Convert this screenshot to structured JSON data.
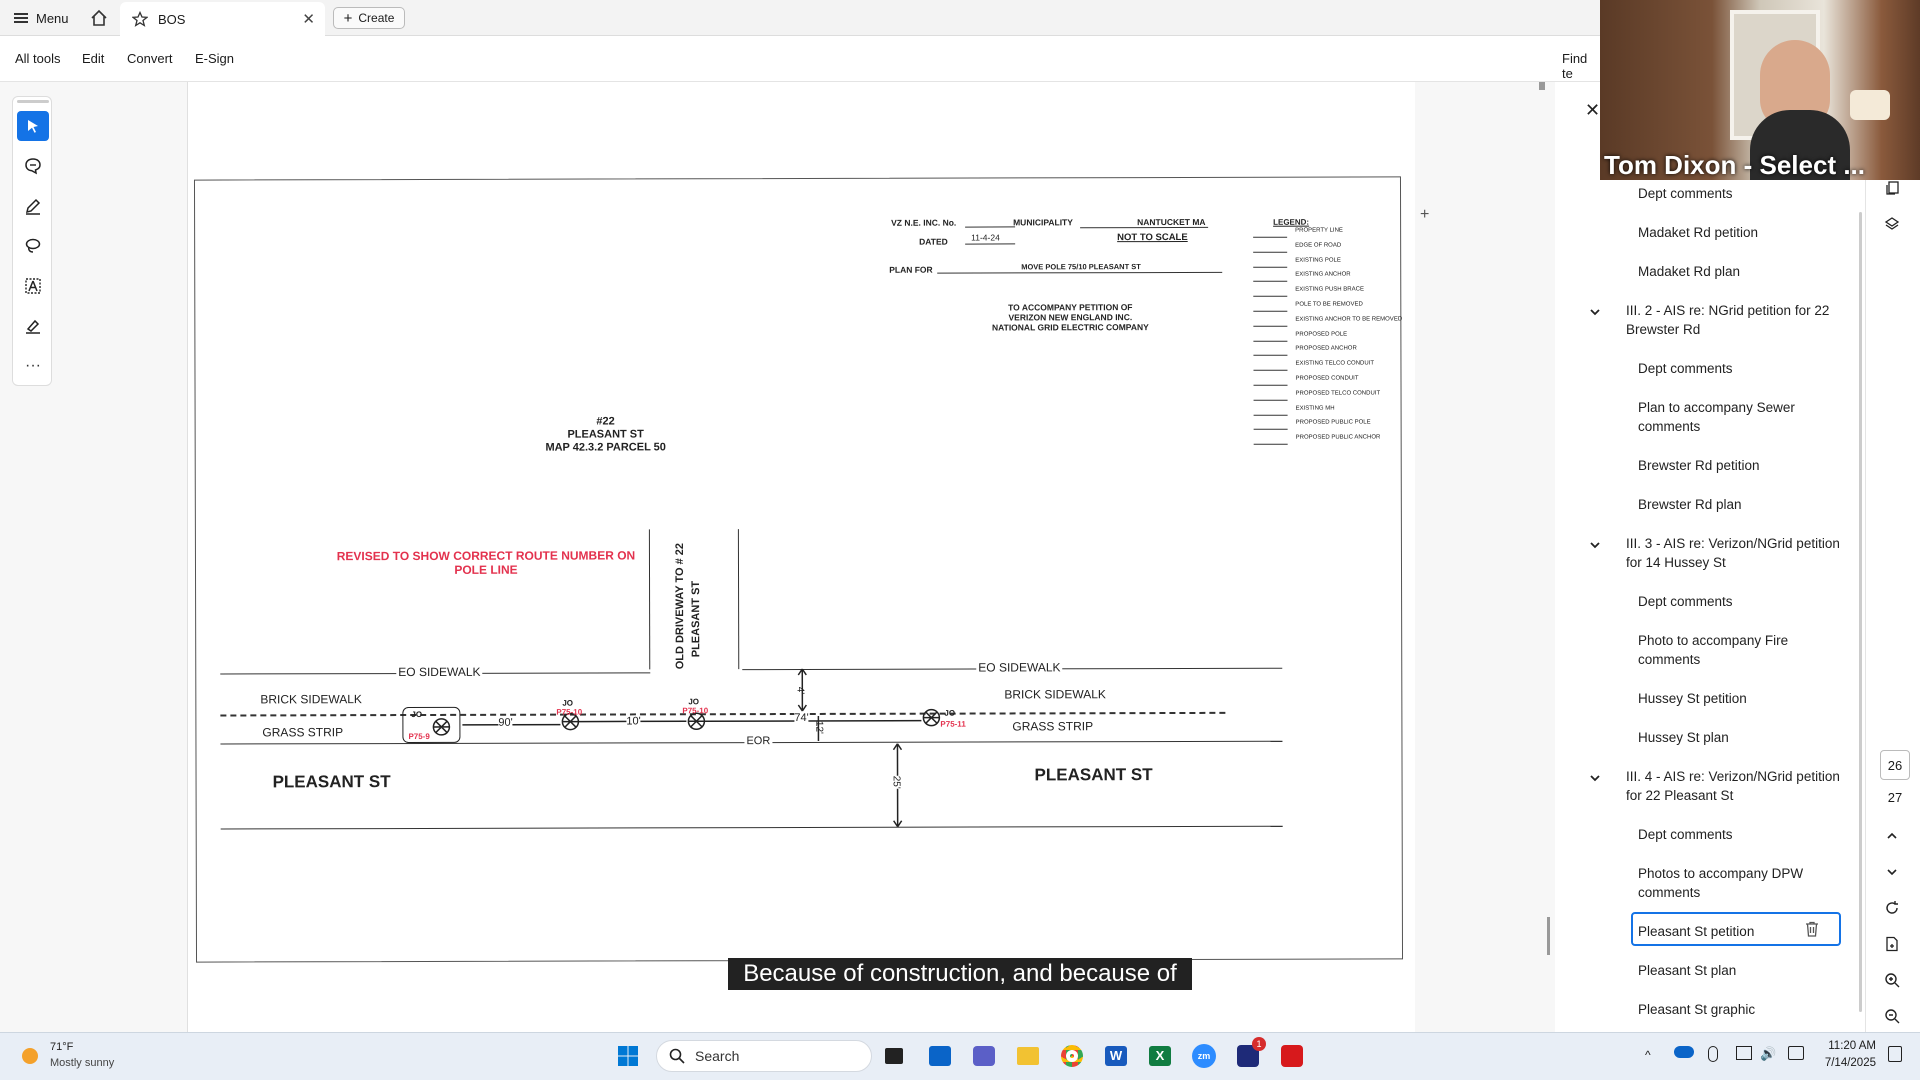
{
  "topbar": {
    "menu_label": "Menu",
    "tab_title": "BOS",
    "create_label": "Create"
  },
  "menubar": {
    "items": [
      "All tools",
      "Edit",
      "Convert",
      "E-Sign"
    ],
    "find_text": "Find te"
  },
  "document": {
    "header": {
      "vz_label": "VZ N.E. INC. No.",
      "municipality_label": "MUNICIPALITY",
      "municipality_value": "NANTUCKET MA",
      "dated_label": "DATED",
      "dated_value": "11-4-24",
      "scale_value": "NOT TO SCALE",
      "plan_for_label": "PLAN FOR",
      "plan_for_value": "MOVE POLE 75/10 PLEASANT ST",
      "accompany_line1": "TO ACCOMPANY PETITION OF",
      "accompany_line2": "VERIZON NEW ENGLAND INC.",
      "accompany_line3": "NATIONAL GRID ELECTRIC COMPANY"
    },
    "legend": {
      "title": "LEGEND:",
      "items": [
        "PROPERTY LINE",
        "EDGE OF ROAD",
        "EXISTING POLE",
        "EXISTING ANCHOR",
        "EXISTING PUSH BRACE",
        "POLE TO BE REMOVED",
        "EXISTING ANCHOR TO BE REMOVED",
        "PROPOSED POLE",
        "PROPOSED ANCHOR",
        "EXISTING TELCO CONDUIT",
        "PROPOSED CONDUIT",
        "PROPOSED TELCO CONDUIT",
        "EXISTING MH",
        "PROPOSED PUBLIC POLE",
        "PROPOSED PUBLIC ANCHOR"
      ]
    },
    "parcel_line1": "#22",
    "parcel_line2": "PLEASANT ST",
    "parcel_line3": "MAP 42.3.2 PARCEL 50",
    "revised_line1": "REVISED TO SHOW CORRECT ROUTE NUMBER ON",
    "revised_line2": "POLE LINE",
    "driveway_line1": "OLD DRIVEWAY TO # 22",
    "driveway_line2": "PLEASANT ST",
    "eo_sidewalk": "EO SIDEWALK",
    "brick_sidewalk": "BRICK SIDEWALK",
    "grass_strip": "GRASS STRIP",
    "pleasant_st": "PLEASANT ST",
    "eor": "EOR",
    "jo": "JO",
    "pole_labels": [
      "P75-9",
      "P75-10",
      "P75-10",
      "P75-11"
    ],
    "dims": [
      "90'",
      "10'",
      "74'",
      "4'",
      "12'",
      "25'"
    ]
  },
  "caption": "Because of construction, and because of",
  "right_panel": {
    "items": [
      {
        "type": "item",
        "label": "Dept comments"
      },
      {
        "type": "item",
        "label": "Madaket Rd petition"
      },
      {
        "type": "item",
        "label": "Madaket Rd plan"
      },
      {
        "type": "section",
        "label": "III. 2 - AIS re: NGrid petition for 22 Brewster Rd"
      },
      {
        "type": "item",
        "label": "Dept comments"
      },
      {
        "type": "item",
        "label": "Plan to accompany Sewer comments"
      },
      {
        "type": "item",
        "label": "Brewster Rd petition"
      },
      {
        "type": "item",
        "label": "Brewster Rd plan"
      },
      {
        "type": "section",
        "label": "III. 3 - AIS re: Verizon/NGrid petition for 14 Hussey St"
      },
      {
        "type": "item",
        "label": "Dept comments"
      },
      {
        "type": "item",
        "label": "Photo to accompany Fire comments"
      },
      {
        "type": "item",
        "label": "Hussey St petition"
      },
      {
        "type": "item",
        "label": "Hussey St plan"
      },
      {
        "type": "section",
        "label": "III. 4 - AIS re: Verizon/NGrid petition for 22 Pleasant St"
      },
      {
        "type": "item",
        "label": "Dept comments"
      },
      {
        "type": "item",
        "label": "Photos to accompany DPW comments"
      },
      {
        "type": "item",
        "label": "Pleasant St petition"
      },
      {
        "type": "item",
        "label": "Pleasant St plan"
      },
      {
        "type": "item",
        "label": "Pleasant St graphic"
      }
    ],
    "selected_index": 16
  },
  "rail": {
    "current_page": "26",
    "next_page": "27"
  },
  "webcam": {
    "name": "Tom Dixon - Select ..."
  },
  "taskbar": {
    "weather_temp": "71°F",
    "weather_desc": "Mostly sunny",
    "search_placeholder": "Search",
    "time": "11:20 AM",
    "date": "7/14/2025",
    "outlook_badge": "1"
  },
  "colors": {
    "accent": "#1473e6",
    "red_text": "#e3324e",
    "pole_red": "#e3324e"
  }
}
